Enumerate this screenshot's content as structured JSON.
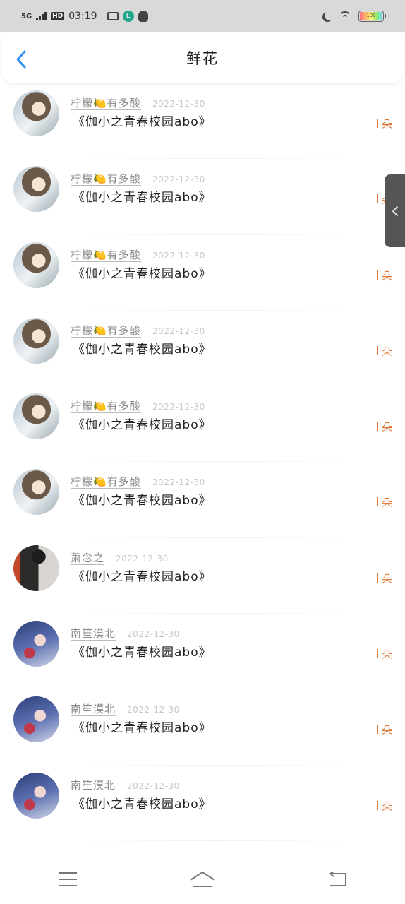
{
  "status_bar": {
    "network": "5G",
    "hd": "HD",
    "time": "03:19",
    "battery_level": "100"
  },
  "header": {
    "title": "鲜花"
  },
  "records": [
    {
      "avatar": "girl",
      "name": "柠檬🍋有多酸",
      "date": "2022-12-30",
      "book": "《伽小之青春校园abo》",
      "unit": "朵"
    },
    {
      "avatar": "girl",
      "name": "柠檬🍋有多酸",
      "date": "2022-12-30",
      "book": "《伽小之青春校园abo》",
      "unit": "朵"
    },
    {
      "avatar": "girl",
      "name": "柠檬🍋有多酸",
      "date": "2022-12-30",
      "book": "《伽小之青春校园abo》",
      "unit": "朵"
    },
    {
      "avatar": "girl",
      "name": "柠檬🍋有多酸",
      "date": "2022-12-30",
      "book": "《伽小之青春校园abo》",
      "unit": "朵"
    },
    {
      "avatar": "girl",
      "name": "柠檬🍋有多酸",
      "date": "2022-12-30",
      "book": "《伽小之青春校园abo》",
      "unit": "朵"
    },
    {
      "avatar": "girl",
      "name": "柠檬🍋有多酸",
      "date": "2022-12-30",
      "book": "《伽小之青春校园abo》",
      "unit": "朵"
    },
    {
      "avatar": "photo",
      "name": "萧念之",
      "date": "2022-12-30",
      "book": "《伽小之青春校园abo》",
      "unit": "朵"
    },
    {
      "avatar": "anime",
      "name": "南笙漠北",
      "date": "2022-12-30",
      "book": "《伽小之青春校园abo》",
      "unit": "朵"
    },
    {
      "avatar": "anime",
      "name": "南笙漠北",
      "date": "2022-12-30",
      "book": "《伽小之青春校园abo》",
      "unit": "朵"
    },
    {
      "avatar": "anime",
      "name": "南笙漠北",
      "date": "2022-12-30",
      "book": "《伽小之青春校园abo》",
      "unit": "朵"
    }
  ],
  "icons": {
    "back": "chevron-left-icon",
    "side_handle": "chevron-left-icon",
    "nav_menu": "menu-icon",
    "nav_home": "home-icon",
    "nav_back": "back-arrow-icon"
  },
  "colors": {
    "accent": "#2f8ff0",
    "gift": "#e07a3a",
    "status_bg": "#d9d9d9"
  }
}
